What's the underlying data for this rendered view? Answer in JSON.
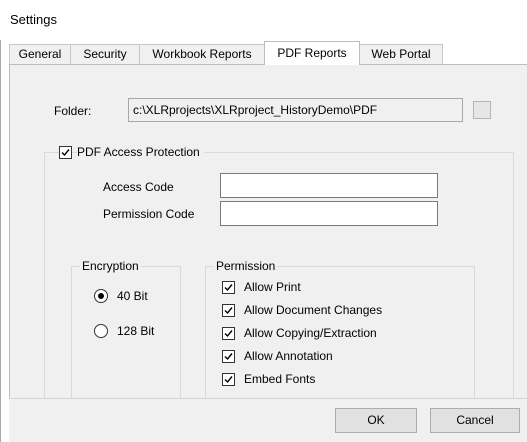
{
  "window": {
    "title": "Settings"
  },
  "tabs": [
    {
      "label": "General",
      "active": false
    },
    {
      "label": "Security",
      "active": false
    },
    {
      "label": "Workbook Reports",
      "active": false
    },
    {
      "label": "PDF Reports",
      "active": true
    },
    {
      "label": "Web Portal",
      "active": false
    }
  ],
  "folder": {
    "label": "Folder:",
    "value": "c:\\XLRprojects\\XLRproject_HistoryDemo\\PDF"
  },
  "protection": {
    "label": "PDF Access Protection",
    "checked": true,
    "access_code_label": "Access Code",
    "access_code_value": "",
    "permission_code_label": "Permission Code",
    "permission_code_value": ""
  },
  "encryption": {
    "label": "Encryption",
    "options": [
      {
        "label": "40 Bit",
        "selected": true
      },
      {
        "label": "128 Bit",
        "selected": false
      }
    ]
  },
  "permission": {
    "label": "Permission",
    "items": [
      {
        "label": "Allow Print",
        "checked": true
      },
      {
        "label": "Allow Document Changes",
        "checked": true
      },
      {
        "label": "Allow Copying/Extraction",
        "checked": true
      },
      {
        "label": "Allow Annotation",
        "checked": true
      },
      {
        "label": "Embed Fonts",
        "checked": true
      }
    ]
  },
  "buttons": {
    "ok": "OK",
    "cancel": "Cancel"
  }
}
